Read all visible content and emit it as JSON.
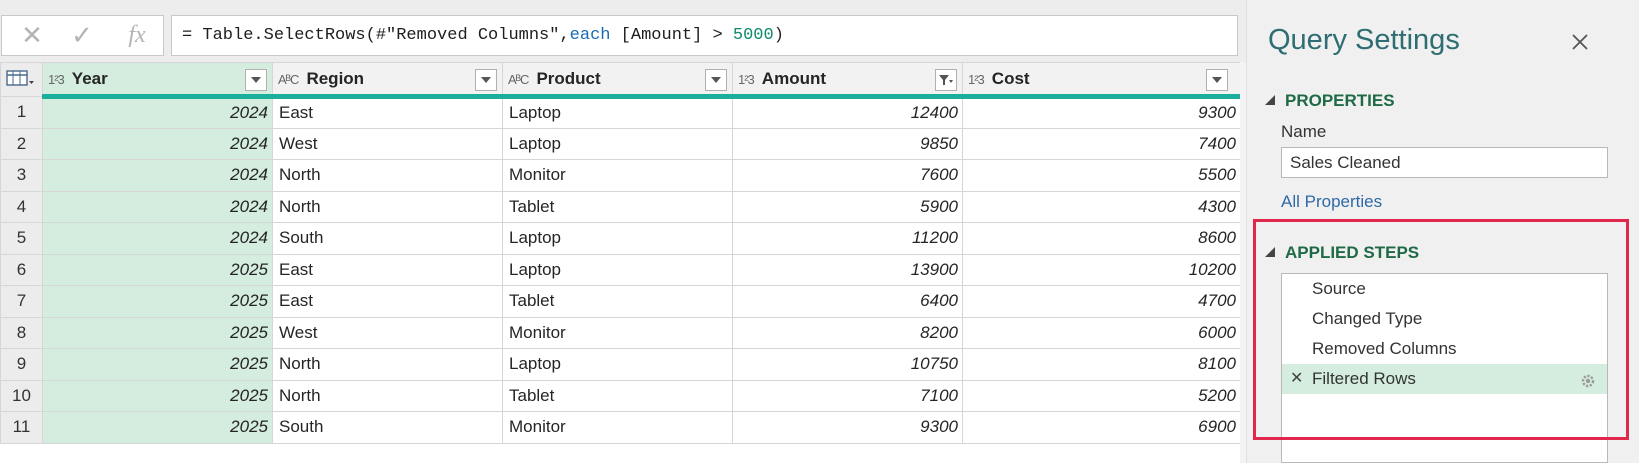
{
  "formula_bar": {
    "cancel_icon": "✕",
    "commit_icon": "✓",
    "fx_label": "fx",
    "formula_parts": {
      "p1": "= Table.SelectRows(#\"Removed Columns\",",
      "p2": "each",
      "p3": " [Amount] > ",
      "p4": "5000",
      "p5": ")"
    }
  },
  "grid": {
    "columns": [
      {
        "type": "1²3",
        "name": "Year"
      },
      {
        "type": "AᴮC",
        "name": "Region"
      },
      {
        "type": "AᴮC",
        "name": "Product"
      },
      {
        "type": "1²3",
        "name": "Amount"
      },
      {
        "type": "1²3",
        "name": "Cost"
      }
    ],
    "rows": [
      {
        "n": "1",
        "year": "2024",
        "region": "East",
        "product": "Laptop",
        "amount": "12400",
        "cost": "9300"
      },
      {
        "n": "2",
        "year": "2024",
        "region": "West",
        "product": "Laptop",
        "amount": "9850",
        "cost": "7400"
      },
      {
        "n": "3",
        "year": "2024",
        "region": "North",
        "product": "Monitor",
        "amount": "7600",
        "cost": "5500"
      },
      {
        "n": "4",
        "year": "2024",
        "region": "North",
        "product": "Tablet",
        "amount": "5900",
        "cost": "4300"
      },
      {
        "n": "5",
        "year": "2024",
        "region": "South",
        "product": "Laptop",
        "amount": "11200",
        "cost": "8600"
      },
      {
        "n": "6",
        "year": "2025",
        "region": "East",
        "product": "Laptop",
        "amount": "13900",
        "cost": "10200"
      },
      {
        "n": "7",
        "year": "2025",
        "region": "East",
        "product": "Tablet",
        "amount": "6400",
        "cost": "4700"
      },
      {
        "n": "8",
        "year": "2025",
        "region": "West",
        "product": "Monitor",
        "amount": "8200",
        "cost": "6000"
      },
      {
        "n": "9",
        "year": "2025",
        "region": "North",
        "product": "Laptop",
        "amount": "10750",
        "cost": "8100"
      },
      {
        "n": "10",
        "year": "2025",
        "region": "North",
        "product": "Tablet",
        "amount": "7100",
        "cost": "5200"
      },
      {
        "n": "11",
        "year": "2025",
        "region": "South",
        "product": "Monitor",
        "amount": "9300",
        "cost": "6900"
      }
    ]
  },
  "query_settings": {
    "title": "Query Settings",
    "properties_header": "PROPERTIES",
    "name_label": "Name",
    "name_value": "Sales Cleaned",
    "all_properties": "All Properties",
    "applied_steps_header": "APPLIED STEPS",
    "steps": [
      "Source",
      "Changed Type",
      "Removed Columns",
      "Filtered Rows"
    ],
    "active_step": "Filtered Rows"
  },
  "colors": {
    "accent": "#1aaf9a",
    "selected_column": "#d4eddf",
    "highlight_box": "#e0284d",
    "section_header": "#1f6a46",
    "pane_title": "#2e6e73"
  }
}
